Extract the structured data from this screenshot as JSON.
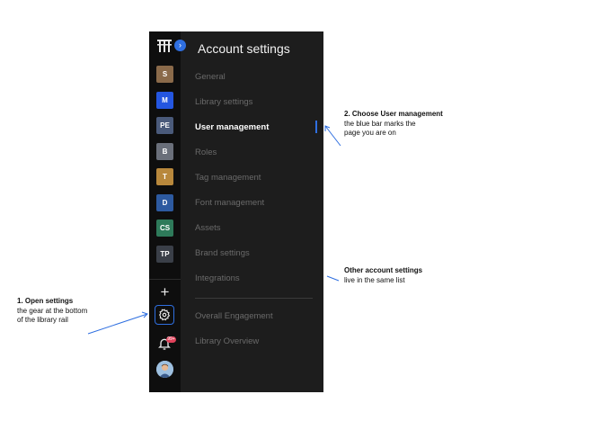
{
  "panel": {
    "title": "Account settings",
    "menu": [
      {
        "label": "General",
        "active": false
      },
      {
        "label": "Library settings",
        "active": false
      },
      {
        "label": "User management",
        "active": true
      },
      {
        "label": "Roles",
        "active": false
      },
      {
        "label": "Tag management",
        "active": false
      },
      {
        "label": "Font management",
        "active": false
      },
      {
        "label": "Assets",
        "active": false
      },
      {
        "label": "Brand settings",
        "active": false
      },
      {
        "label": "Integrations",
        "active": false
      }
    ],
    "secondary_menu": [
      {
        "label": "Overall Engagement"
      },
      {
        "label": "Library Overview"
      }
    ]
  },
  "rail": {
    "libraries": [
      {
        "initials": "S",
        "color": "#8a6a4a"
      },
      {
        "initials": "M",
        "color": "#2456e0"
      },
      {
        "initials": "PE",
        "color": "#4a5a7a"
      },
      {
        "initials": "B",
        "color": "#6a6f7a"
      },
      {
        "initials": "T",
        "color": "#b8883c"
      },
      {
        "initials": "D",
        "color": "#2d5aa0"
      },
      {
        "initials": "CS",
        "color": "#2e7a5a"
      },
      {
        "initials": "TP",
        "color": "#3a3f48"
      }
    ],
    "notification_badge": "99+",
    "icons": {
      "logo": "logo-icon",
      "expand": "chevron-right-icon",
      "add": "plus-icon",
      "settings": "gear-icon",
      "notifications": "bell-icon",
      "profile": "avatar"
    }
  },
  "annotations": {
    "step1_title": "1. Open settings",
    "step1_line1": "the gear at the bottom",
    "step1_line2": "of the library rail",
    "step2_title": "2. Choose User management",
    "step2_line1": "the blue bar marks the",
    "step2_line2": "page you are on",
    "other_title": "Other account settings",
    "other_line1": "live in the same list"
  },
  "colors": {
    "accent": "#2f6fe0",
    "rail_bg": "#0e0e0e",
    "panel_bg": "#1d1d1d"
  }
}
